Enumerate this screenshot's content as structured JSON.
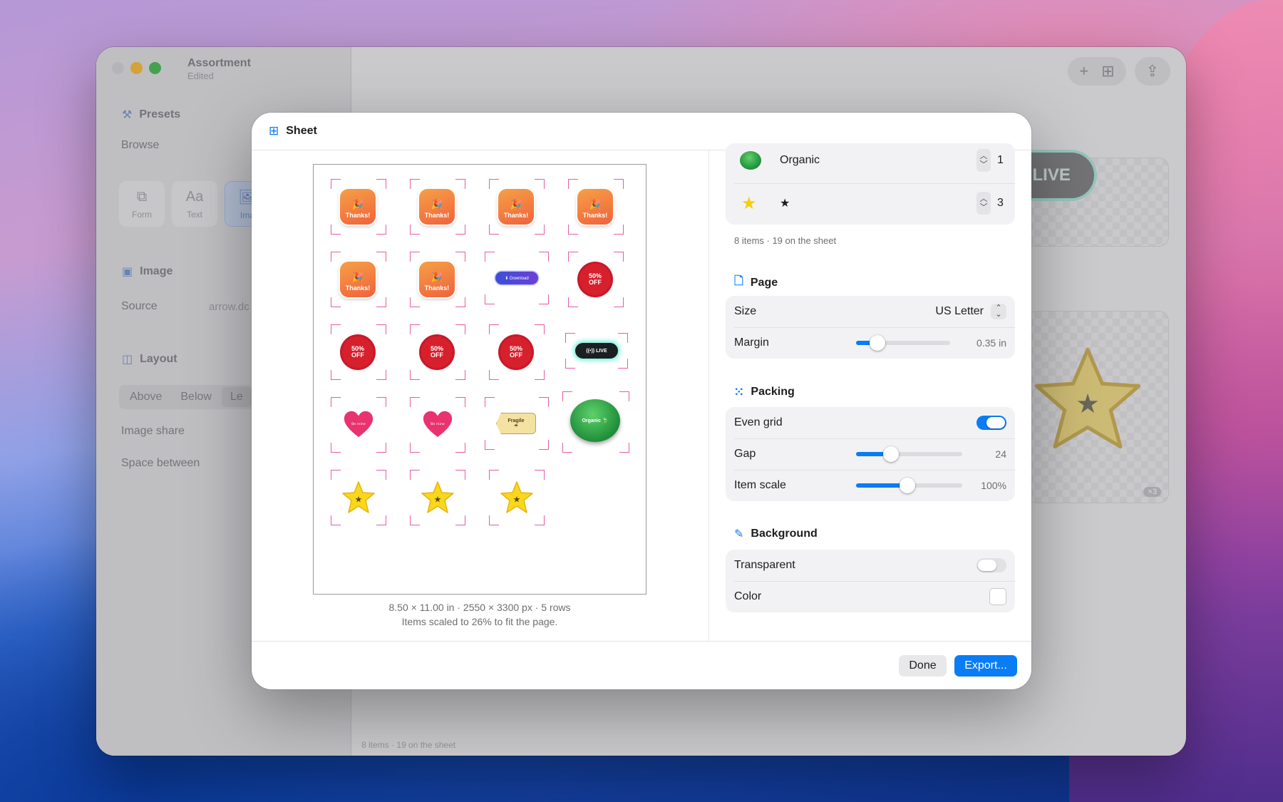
{
  "window": {
    "title": "Assortment",
    "subtitle": "Edited",
    "status": "8 items · 19 on the sheet"
  },
  "sidebar": {
    "presets_label": "Presets",
    "browse_label": "Browse",
    "tiles": [
      {
        "label": "Form",
        "glyph": "⧉"
      },
      {
        "label": "Text",
        "glyph": "Aa"
      },
      {
        "label": "Ima",
        "glyph": "🖼"
      }
    ],
    "image_label": "Image",
    "source_label": "Source",
    "source_value": "arrow.dc",
    "layout_label": "Layout",
    "layout_options": [
      "Above",
      "Below",
      "Le"
    ],
    "image_share_label": "Image share",
    "space_between_label": "Space between"
  },
  "background_preview": {
    "live_label": "LIVE",
    "badge": "×3"
  },
  "sheet": {
    "title": "Sheet",
    "items": [
      {
        "name": "Organic",
        "count": "1"
      },
      {
        "name": "★",
        "count": "3"
      }
    ],
    "items_summary": "8 items · 19 on the sheet",
    "page_info_line1": "8.50 × 11.00 in · 2550 × 3300 px · 5 rows",
    "page_info_line2": "Items scaled to 26% to fit the page.",
    "page": {
      "title": "Page",
      "size_label": "Size",
      "size_value": "US Letter",
      "margin_label": "Margin",
      "margin_value": "0.35 in",
      "margin_fraction": 0.23
    },
    "packing": {
      "title": "Packing",
      "even_grid_label": "Even grid",
      "even_grid": true,
      "gap_label": "Gap",
      "gap_value": "24",
      "gap_fraction": 0.33,
      "item_scale_label": "Item scale",
      "item_scale_value": "100%",
      "item_scale_fraction": 0.48
    },
    "background": {
      "title": "Background",
      "transparent_label": "Transparent",
      "transparent": false,
      "color_label": "Color",
      "color": "#ffffff"
    },
    "buttons": {
      "done": "Done",
      "export": "Export..."
    },
    "stickers": {
      "thanks": "Thanks!",
      "off_line1": "50%",
      "off_line2": "OFF",
      "download": "Download",
      "live": "LIVE",
      "heart": "Be mine",
      "fragile": "Fragile",
      "organic": "Organic"
    }
  },
  "colors": {
    "accent": "#0a7cf5",
    "crop_marks": "#e35da6"
  }
}
